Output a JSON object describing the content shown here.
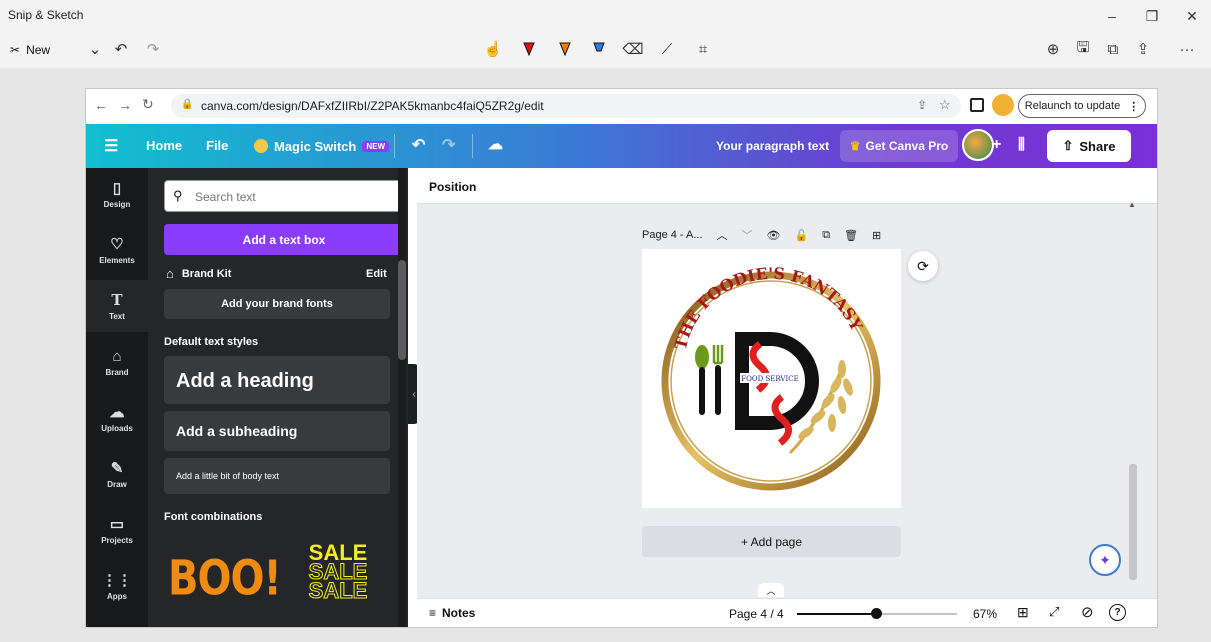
{
  "window": {
    "title": "Snip & Sketch",
    "minimize": "–",
    "restore": "❐",
    "close": "✕"
  },
  "snip_toolbar": {
    "new_label": "New",
    "more": "···"
  },
  "browser": {
    "url": "canva.com/design/DAFxfZIIRbI/Z2PAK5kmanbc4faiQ5ZR2g/edit",
    "relaunch_label": "Relaunch to update"
  },
  "canva_header": {
    "home": "Home",
    "file": "File",
    "magic_switch": "Magic Switch",
    "new_badge": "NEW",
    "doc_title": "Your paragraph text",
    "get_pro": "Get Canva Pro",
    "share": "Share",
    "accent": "#8b3dff"
  },
  "rail": {
    "items": [
      {
        "label": "Design",
        "icon": "▯"
      },
      {
        "label": "Elements",
        "icon": "♡"
      },
      {
        "label": "Text",
        "icon": "T"
      },
      {
        "label": "Brand",
        "icon": "⌂"
      },
      {
        "label": "Uploads",
        "icon": "☁"
      },
      {
        "label": "Draw",
        "icon": "✎"
      },
      {
        "label": "Projects",
        "icon": "▭"
      },
      {
        "label": "Apps",
        "icon": "⋮⋮"
      }
    ]
  },
  "panel": {
    "search_placeholder": "Search text",
    "add_text_box": "Add a text box",
    "brand_kit": "Brand Kit",
    "edit": "Edit",
    "add_brand_fonts": "Add your brand fonts",
    "default_styles": "Default text styles",
    "heading": "Add a heading",
    "subheading": "Add a subheading",
    "body": "Add a little bit of body text",
    "font_combinations": "Font combinations",
    "boo": "BOO!",
    "sale": "SALE"
  },
  "canvas": {
    "position": "Position",
    "page_label": "Page 4 - A...",
    "logo_title": "THE FOODIE'S FANTASY",
    "logo_sub": "FOOD SERVICE",
    "add_page": "+ Add page"
  },
  "status": {
    "notes": "Notes",
    "page_count": "Page 4 / 4",
    "zoom": "67%",
    "zoom_fraction": 0.67
  }
}
